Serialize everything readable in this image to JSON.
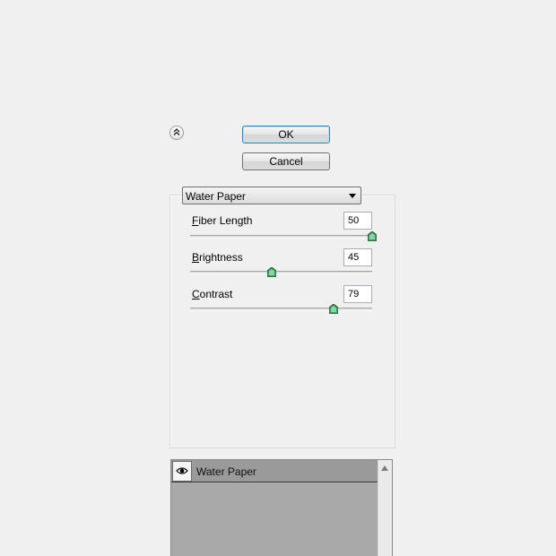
{
  "buttons": {
    "ok": "OK",
    "cancel": "Cancel"
  },
  "filter_select": {
    "value": "Water Paper"
  },
  "sliders": [
    {
      "label": "Fiber Length",
      "mnemonic": "F",
      "rest": "iber Length",
      "value": "50",
      "level": 1.0
    },
    {
      "label": "Brightness",
      "mnemonic": "B",
      "rest": "rightness",
      "value": "45",
      "level": 0.45
    },
    {
      "label": "Contrast",
      "mnemonic": "C",
      "rest": "ontrast",
      "value": "79",
      "level": 0.79
    }
  ],
  "layers": [
    {
      "name": "Water Paper",
      "visible": true
    }
  ],
  "icons": {
    "collapse": "double-chevron-up-icon",
    "dropdown": "triangle-down-icon",
    "visibility": "eye-icon",
    "scroll_up": "triangle-up-icon"
  },
  "colors": {
    "thumb": "#3c9a5f",
    "layer_row": "#9a9a9a",
    "layer_list": "#a9a9a9",
    "ok_focus": "#3c7fb1"
  }
}
